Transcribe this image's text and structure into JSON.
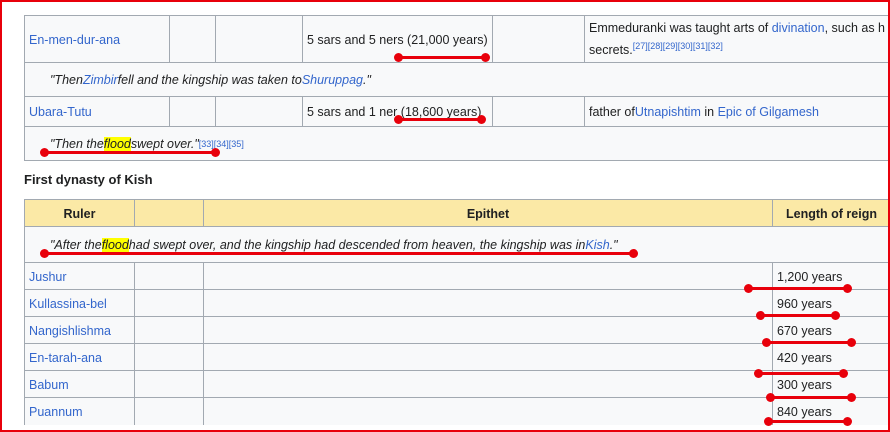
{
  "top_table": {
    "rows": [
      {
        "ruler": "En-men-dur-ana",
        "length": "5 sars and 5 ners (21,000 years)",
        "notes_prefix": "Emmeduranki was taught arts of ",
        "notes_link": "divination",
        "notes_suffix": ", such as h",
        "notes_line2": "secrets.",
        "notes_refs": "[27][28][29][30][31][32]"
      },
      {
        "ruler": "Ubara-Tutu",
        "length": "5 sars and 1 ner (18,600 years)",
        "notes_prefix": "father of ",
        "notes_link": "Utnapishtim",
        "notes_mid": " in ",
        "notes_link2": "Epic of Gilgamesh"
      }
    ],
    "quote1": {
      "pre": "\"Then ",
      "link1": "Zimbir",
      "mid": " fell and the kingship was taken to ",
      "link2": "Shuruppag",
      "post": ".\""
    },
    "quote2": {
      "pre": "\"Then the ",
      "highlight": "flood",
      "post": " swept over.\"",
      "refs": "[33][34][35]"
    }
  },
  "section_title": "First dynasty of Kish",
  "kish_table": {
    "headers": {
      "ruler": "Ruler",
      "epithet": "Epithet",
      "length": "Length of reign"
    },
    "quote": {
      "pre": "\"After the ",
      "highlight": "flood",
      "mid": " had swept over, and the kingship had descended from heaven, the kingship was in ",
      "link": "Kish",
      "post": ".\""
    },
    "rows": [
      {
        "ruler": "Jushur",
        "length": "1,200 years"
      },
      {
        "ruler": "Kullassina-bel",
        "length": "960 years"
      },
      {
        "ruler": "Nangishlishma",
        "length": "670 years"
      },
      {
        "ruler": "En-tarah-ana",
        "length": "420 years"
      },
      {
        "ruler": "Babum",
        "length": "300 years"
      },
      {
        "ruler": "Puannum",
        "length": "840 years"
      }
    ]
  },
  "annotation_color": "#e8000b"
}
